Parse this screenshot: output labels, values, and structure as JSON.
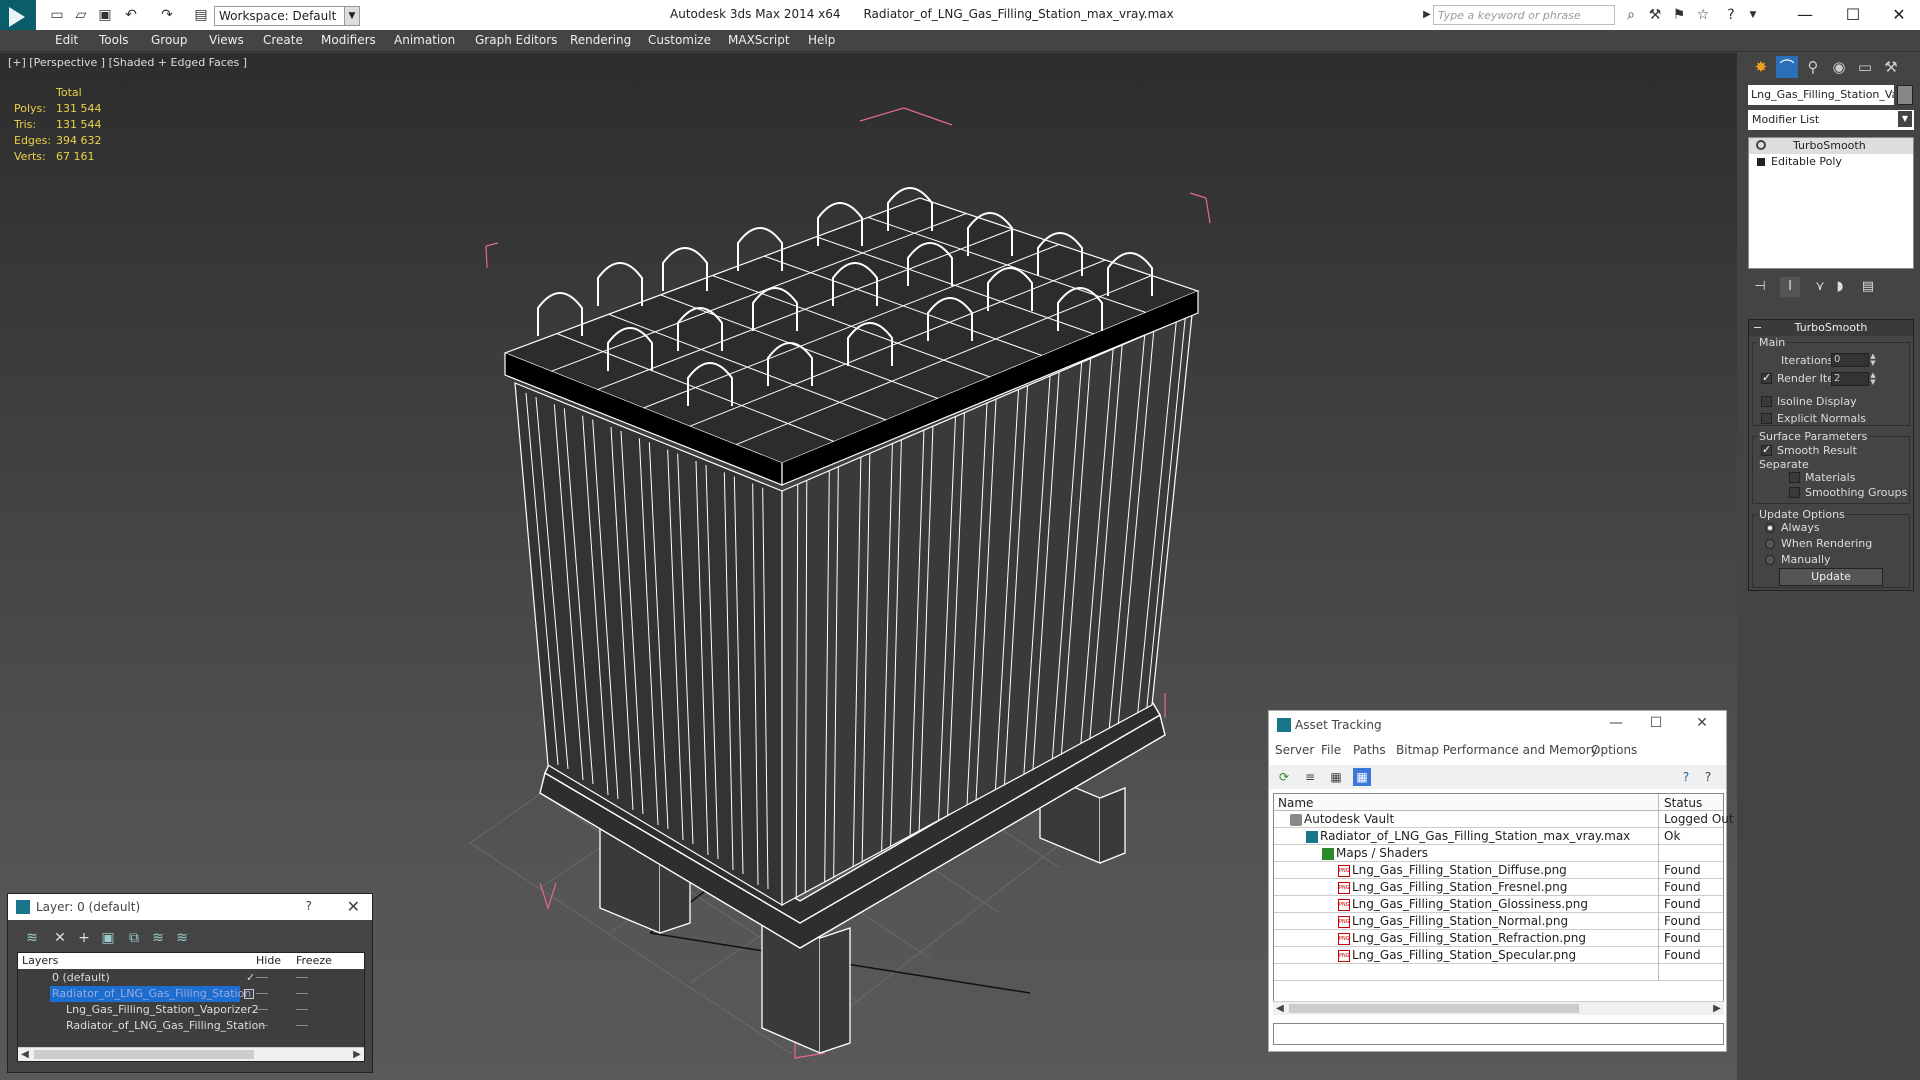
{
  "titlebar": {
    "app_title": "Autodesk 3ds Max  2014 x64",
    "file_title": "Radiator_of_LNG_Gas_Filling_Station_max_vray.max",
    "workspace_label": "Workspace: Default",
    "search_placeholder": "Type a keyword or phrase"
  },
  "menu": [
    "Edit",
    "Tools",
    "Group",
    "Views",
    "Create",
    "Modifiers",
    "Animation",
    "Graph Editors",
    "Rendering",
    "Customize",
    "MAXScript",
    "Help"
  ],
  "viewport": {
    "label": "[+] [Perspective ] [Shaded + Edged Faces ]",
    "stats_header": "Total",
    "stats": [
      {
        "key": "Polys:",
        "value": "131 544"
      },
      {
        "key": "Tris:",
        "value": "131 544"
      },
      {
        "key": "Edges:",
        "value": "394 632"
      },
      {
        "key": "Verts:",
        "value": "67 161"
      }
    ]
  },
  "command_panel": {
    "object_name": "Lng_Gas_Filling_Station_Vapc",
    "modifier_list": "Modifier List",
    "stack": [
      "TurboSmooth",
      "Editable Poly"
    ],
    "rollout_title": "TurboSmooth",
    "main_label": "Main",
    "iterations_label": "Iterations:",
    "iterations_value": "0",
    "render_iters_label": "Render Iters:",
    "render_iters_value": "2",
    "isoline_label": "Isoline Display",
    "explicit_normals_label": "Explicit Normals",
    "surface_params_label": "Surface Parameters",
    "smooth_result_label": "Smooth Result",
    "separate_label": "Separate",
    "materials_label": "Materials",
    "smoothing_groups_label": "Smoothing Groups",
    "update_options_label": "Update Options",
    "always_label": "Always",
    "when_rendering_label": "When Rendering",
    "manually_label": "Manually",
    "update_button": "Update"
  },
  "layer_window": {
    "title": "Layer: 0 (default)",
    "help": "?",
    "col_layers": "Layers",
    "col_hide": "Hide",
    "col_freeze": "Freeze",
    "rows": [
      {
        "name": "0 (default)"
      },
      {
        "name": "Radiator_of_LNG_Gas_Filling_Station"
      },
      {
        "name": "Lng_Gas_Filling_Station_Vaporizer2"
      },
      {
        "name": "Radiator_of_LNG_Gas_Filling_Station"
      }
    ]
  },
  "asset_tracking": {
    "title": "Asset Tracking",
    "menu": [
      "Server",
      "File",
      "Paths",
      "Bitmap Performance and Memory",
      "Options"
    ],
    "col_name": "Name",
    "col_status": "Status",
    "rows": [
      {
        "name": "Autodesk Vault",
        "status": "Logged Out"
      },
      {
        "name": "Radiator_of_LNG_Gas_Filling_Station_max_vray.max",
        "status": "Ok"
      },
      {
        "name": "Maps / Shaders",
        "status": ""
      },
      {
        "name": "Lng_Gas_Filling_Station_Diffuse.png",
        "status": "Found"
      },
      {
        "name": "Lng_Gas_Filling_Station_Fresnel.png",
        "status": "Found"
      },
      {
        "name": "Lng_Gas_Filling_Station_Glossiness.png",
        "status": "Found"
      },
      {
        "name": "Lng_Gas_Filling_Station_Normal.png",
        "status": "Found"
      },
      {
        "name": "Lng_Gas_Filling_Station_Refraction.png",
        "status": "Found"
      },
      {
        "name": "Lng_Gas_Filling_Station_Specular.png",
        "status": "Found"
      }
    ]
  },
  "colors": {
    "stats_text": "#e8d24a",
    "selection_blue": "#1c6dd0",
    "bbox_pink": "#e26a8a",
    "app_teal": "#19768a"
  }
}
